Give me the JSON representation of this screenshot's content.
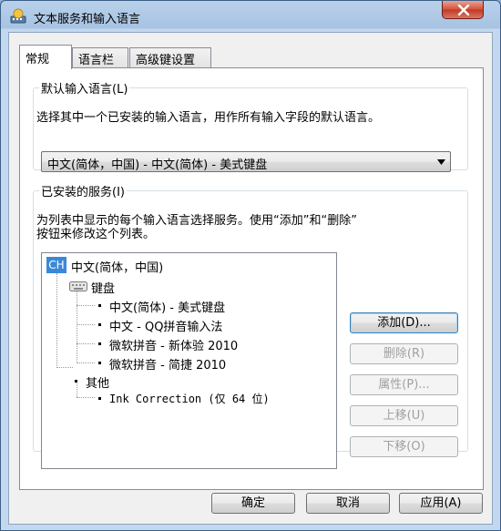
{
  "window": {
    "title": "文本服务和输入语言"
  },
  "tabs": [
    {
      "label": "常规"
    },
    {
      "label": "语言栏"
    },
    {
      "label": "高级键设置"
    }
  ],
  "default_language": {
    "legend": "默认输入语言(L)",
    "description": "选择其中一个已安装的输入语言，用作所有输入字段的默认语言。",
    "selected": "中文(简体，中国) - 中文(简体) - 美式键盘"
  },
  "installed_services": {
    "legend": "已安装的服务(I)",
    "description_line1": "为列表中显示的每个输入语言选择服务。使用“添加”和“删除”",
    "description_line2": "按钮来修改这个列表。",
    "tree": {
      "language_badge": "CH",
      "language": "中文(简体，中国)",
      "keyboard_group": "键盘",
      "keyboards": [
        "中文(简体) - 美式键盘",
        "中文 - QQ拼音输入法",
        "微软拼音 - 新体验 2010",
        "微软拼音 - 简捷 2010"
      ],
      "other_group": "其他",
      "others": [
        "Ink Correction (仅 64 位)"
      ]
    },
    "buttons": {
      "add": "添加(D)...",
      "remove": "删除(R)",
      "properties": "属性(P)...",
      "move_up": "上移(U)",
      "move_down": "下移(O)"
    }
  },
  "footer": {
    "ok": "确定",
    "cancel": "取消",
    "apply": "应用(A)"
  },
  "colors": {
    "title_glass": "#b9d1ea",
    "selection": "#3a89d6",
    "close_button": "#c23a22"
  },
  "icons": {
    "app": "language-settings-icon",
    "close": "close-icon",
    "dropdown": "chevron-down-icon",
    "keyboard": "keyboard-icon"
  }
}
